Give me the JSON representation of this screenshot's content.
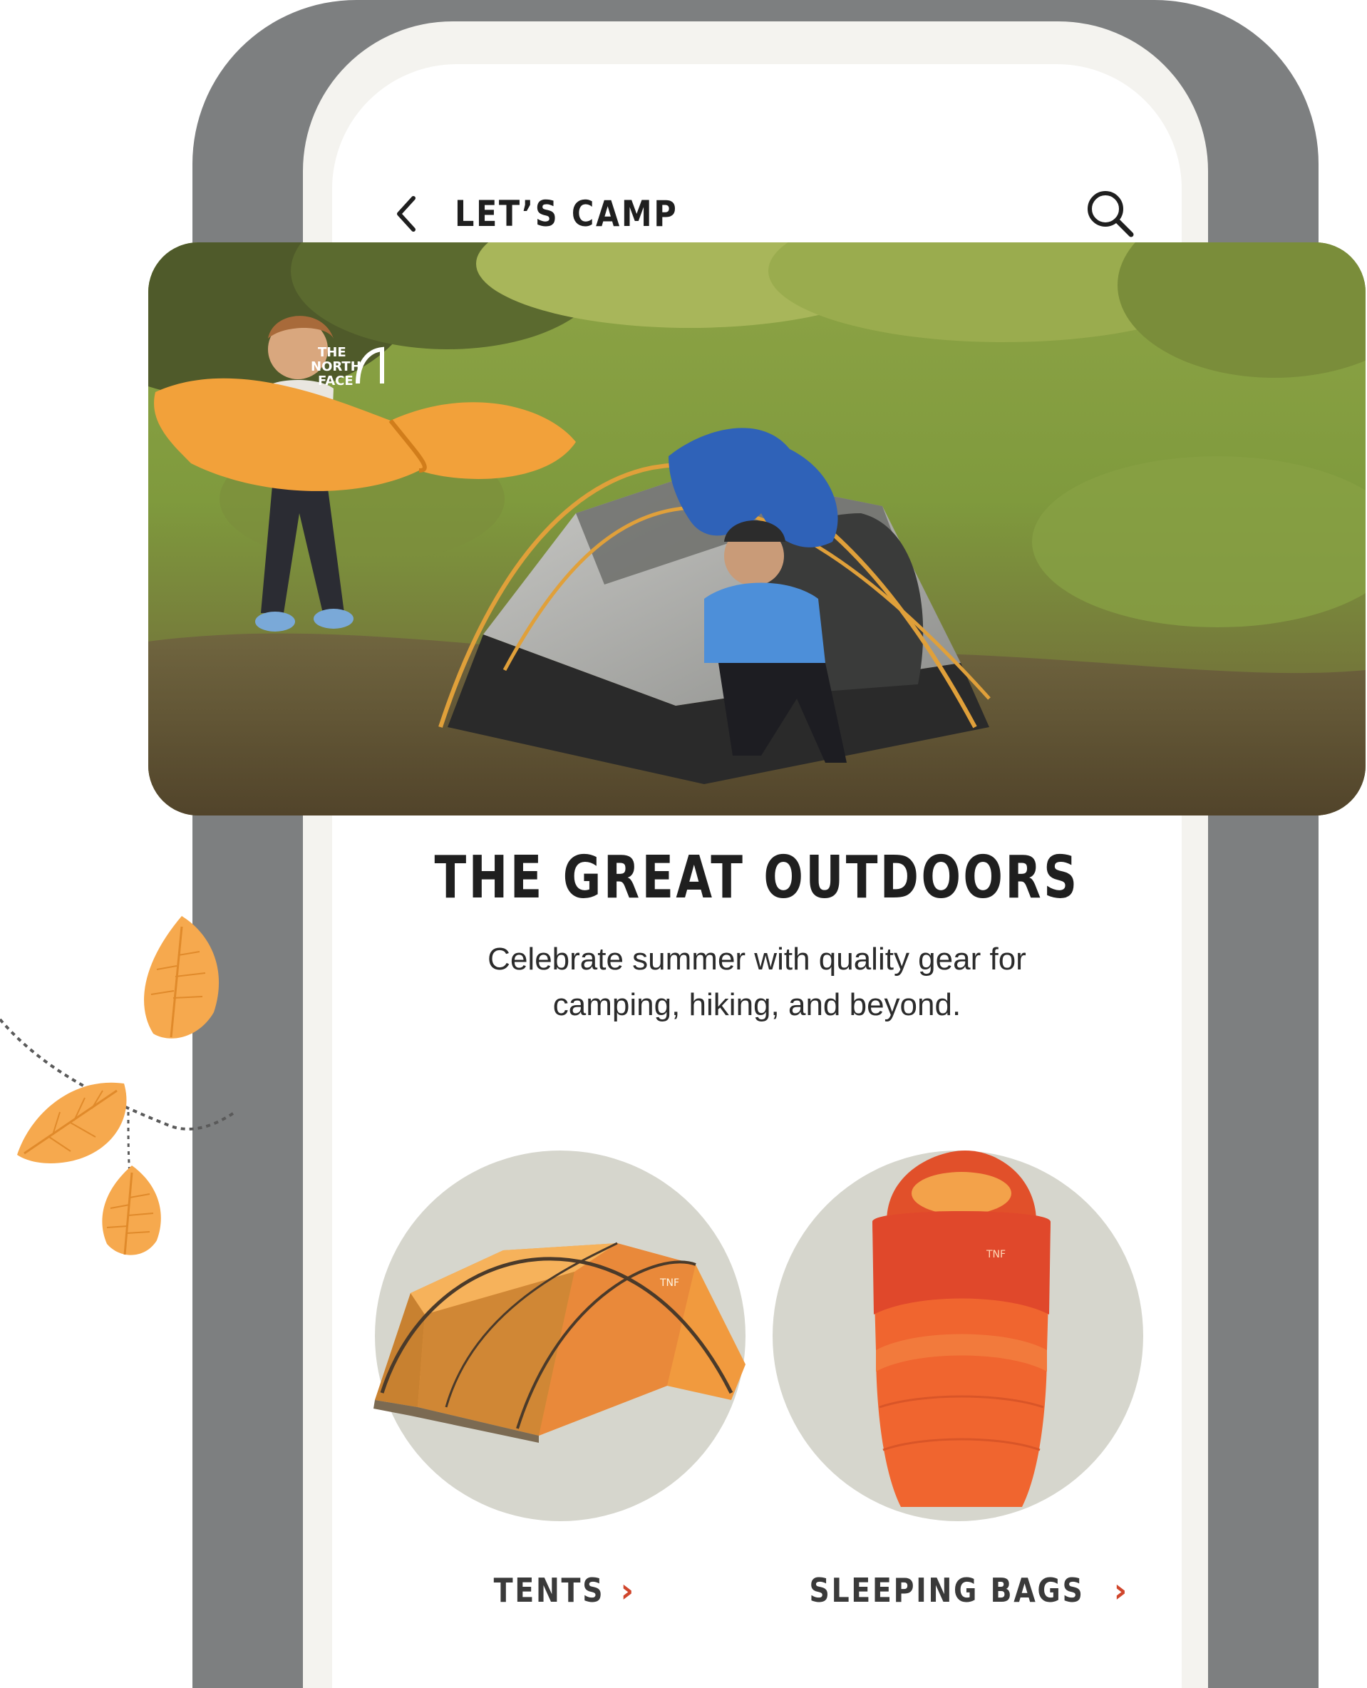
{
  "header": {
    "title": "LET’S CAMP",
    "back_icon": "chevron-left-icon",
    "search_icon": "search-icon"
  },
  "hero": {
    "brand_logo_text": "THE NORTH FACE"
  },
  "section": {
    "title": "THE GREAT OUTDOORS",
    "subtitle": "Celebrate summer with quality gear for camping, hiking, and beyond."
  },
  "categories": [
    {
      "label": "TENTS",
      "icon": "chevron-right-icon"
    },
    {
      "label": "SLEEPING BAGS",
      "icon": "chevron-right-icon"
    }
  ],
  "colors": {
    "accent_chevron": "#d0462c",
    "circle_bg": "#d6d6cd",
    "tent_orange": "#f19a3e",
    "sleeping_bag_orange": "#f0652f",
    "leaf_orange": "#f6a94e",
    "frame": "#f4f3ef",
    "backdrop": "#7d7f80"
  }
}
